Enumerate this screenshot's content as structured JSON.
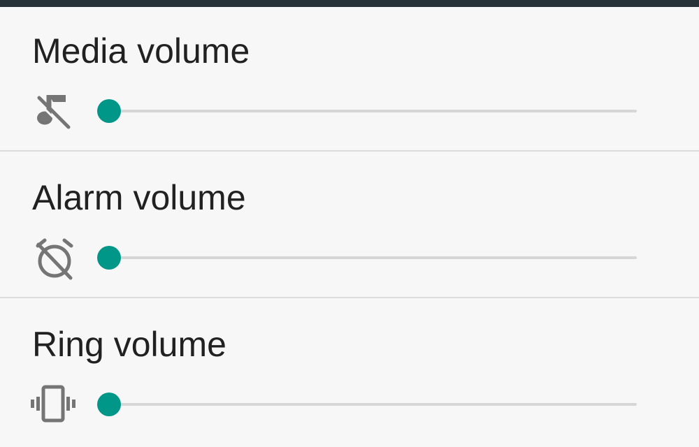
{
  "colors": {
    "accent": "#009688",
    "track": "#d6d6d6",
    "icon": "#757575",
    "text": "#212121",
    "background": "#f7f7f7",
    "status_bar": "#263238"
  },
  "volumes": [
    {
      "label": "Media volume",
      "icon": "music-off-icon",
      "level": 0
    },
    {
      "label": "Alarm volume",
      "icon": "alarm-off-icon",
      "level": 0
    },
    {
      "label": "Ring volume",
      "icon": "vibrate-icon",
      "level": 0
    }
  ]
}
